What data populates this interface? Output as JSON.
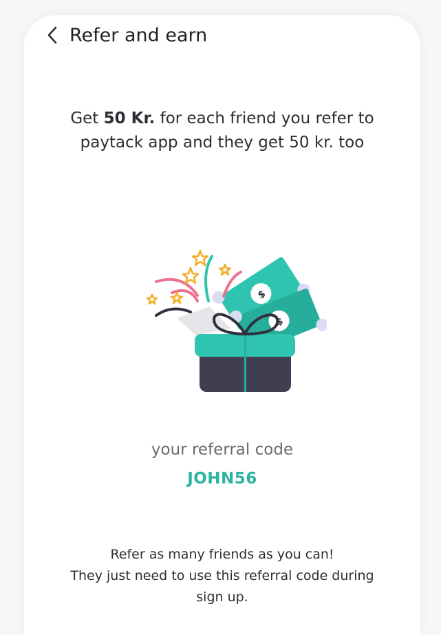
{
  "header": {
    "title": "Refer and earn",
    "back_icon": "chevron-left-icon"
  },
  "headline": {
    "prefix": "Get ",
    "amount": "50 Kr.",
    "suffix_line1": " for each friend you refer to",
    "line2": "paytack app and they get 50 kr. too"
  },
  "illustration": {
    "name": "gift-box-with-money-illustration",
    "colors": {
      "teal": "#2ec4b0",
      "dark_teal": "#27ad9c",
      "box_dark": "#403f52",
      "ribbon": "#2f2f3d",
      "pink": "#ec6f8e",
      "star": "#f4b02a"
    }
  },
  "referral": {
    "label": "your referral code",
    "code": "JOHN56"
  },
  "info": {
    "line1": "Refer as many friends as you can!",
    "line2": "They just need to use this referral code during",
    "line3": "sign up."
  }
}
